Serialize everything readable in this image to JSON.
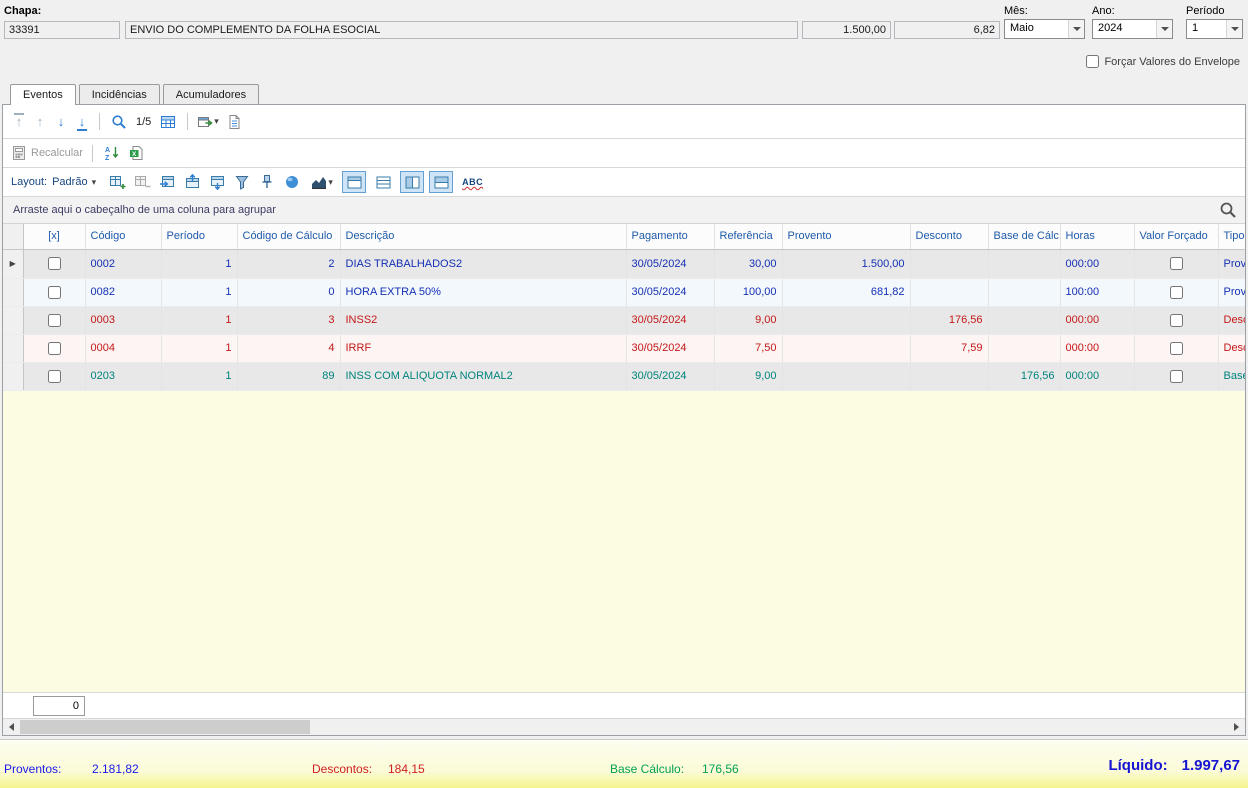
{
  "colors": {
    "provento": "#1430b4",
    "desconto": "#c41818",
    "base": "#00837b",
    "header_text": "#1f5aa8",
    "footer_proventos": "#1a1ae6",
    "footer_descontos": "#d02020",
    "footer_base": "#00a050",
    "footer_liquido": "#1414d2",
    "panel_yellow": "#fcfce2",
    "toolbar_blue": "#2d7dd2"
  },
  "icons": {
    "up_arrow": "↑",
    "down_arrow": "↓",
    "dropdown_caret": "▾",
    "current_row_marker": "▶"
  },
  "header": {
    "chapa_label": "Chapa:",
    "chapa": "33391",
    "descricao": "ENVIO DO COMPLEMENTO DA FOLHA ESOCIAL",
    "valor": "1.500,00",
    "referencia": "6,82",
    "mes_label": "Mês:",
    "mes": "Maio",
    "ano_label": "Ano:",
    "ano": "2024",
    "periodo_label": "Período",
    "periodo": "1",
    "forcar_label": "Forçar Valores do Envelope"
  },
  "tabs": {
    "eventos": "Eventos",
    "incidencias": "Incidências",
    "acumuladores": "Acumuladores"
  },
  "toolbar": {
    "record_counter": "1/5",
    "recalcular": "Recalcular",
    "layout_label": "Layout:",
    "layout_value": "Padrão",
    "group_hint": "Arraste aqui o cabeçalho de uma coluna para agrupar",
    "abc": "ABC"
  },
  "table": {
    "columns": [
      {
        "key": "sel",
        "label": "[x]",
        "type": "check"
      },
      {
        "key": "codigo",
        "label": "Código"
      },
      {
        "key": "periodo",
        "label": "Período",
        "align": "right"
      },
      {
        "key": "codcalc",
        "label": "Código de Cálculo",
        "align": "right"
      },
      {
        "key": "descricao",
        "label": "Descrição"
      },
      {
        "key": "pagamento",
        "label": "Pagamento"
      },
      {
        "key": "referencia",
        "label": "Referência",
        "align": "right"
      },
      {
        "key": "provento",
        "label": "Provento",
        "align": "right"
      },
      {
        "key": "desconto",
        "label": "Desconto",
        "align": "right"
      },
      {
        "key": "basecalc",
        "label": "Base de Cálc...",
        "align": "right"
      },
      {
        "key": "horas",
        "label": "Horas"
      },
      {
        "key": "valorforcado",
        "label": "Valor Forçado",
        "type": "check"
      },
      {
        "key": "tipo",
        "label": "Tipo E"
      }
    ],
    "rows": [
      {
        "type": "provento",
        "current": true,
        "codigo": "0002",
        "periodo": "1",
        "codcalc": "2",
        "descricao": "DIAS TRABALHADOS2",
        "pagamento": "30/05/2024",
        "referencia": "30,00",
        "provento": "1.500,00",
        "desconto": "",
        "basecalc": "",
        "horas": "000:00",
        "tipo": "Prove"
      },
      {
        "type": "provento",
        "codigo": "0082",
        "periodo": "1",
        "codcalc": "0",
        "descricao": "HORA EXTRA 50%",
        "pagamento": "30/05/2024",
        "referencia": "100,00",
        "provento": "681,82",
        "desconto": "",
        "basecalc": "",
        "horas": "100:00",
        "tipo": "Prove"
      },
      {
        "type": "desconto",
        "codigo": "0003",
        "periodo": "1",
        "codcalc": "3",
        "descricao": "INSS2",
        "pagamento": "30/05/2024",
        "referencia": "9,00",
        "provento": "",
        "desconto": "176,56",
        "basecalc": "",
        "horas": "000:00",
        "tipo": "Desc"
      },
      {
        "type": "desconto",
        "codigo": "0004",
        "periodo": "1",
        "codcalc": "4",
        "descricao": "IRRF",
        "pagamento": "30/05/2024",
        "referencia": "7,50",
        "provento": "",
        "desconto": "7,59",
        "basecalc": "",
        "horas": "000:00",
        "tipo": "Desc"
      },
      {
        "type": "base",
        "codigo": "0203",
        "periodo": "1",
        "codcalc": "89",
        "descricao": "INSS COM ALIQUOTA NORMAL2",
        "pagamento": "30/05/2024",
        "referencia": "9,00",
        "provento": "",
        "desconto": "",
        "basecalc": "176,56",
        "horas": "000:00",
        "tipo": "Base"
      }
    ]
  },
  "bottom": {
    "counter": "0"
  },
  "footer": {
    "proventos_label": "Proventos:",
    "proventos": "2.181,82",
    "descontos_label": "Descontos:",
    "descontos": "184,15",
    "base_label": "Base Cálculo:",
    "base": "176,56",
    "liquido_label": "Líquido:",
    "liquido": "1.997,67"
  }
}
